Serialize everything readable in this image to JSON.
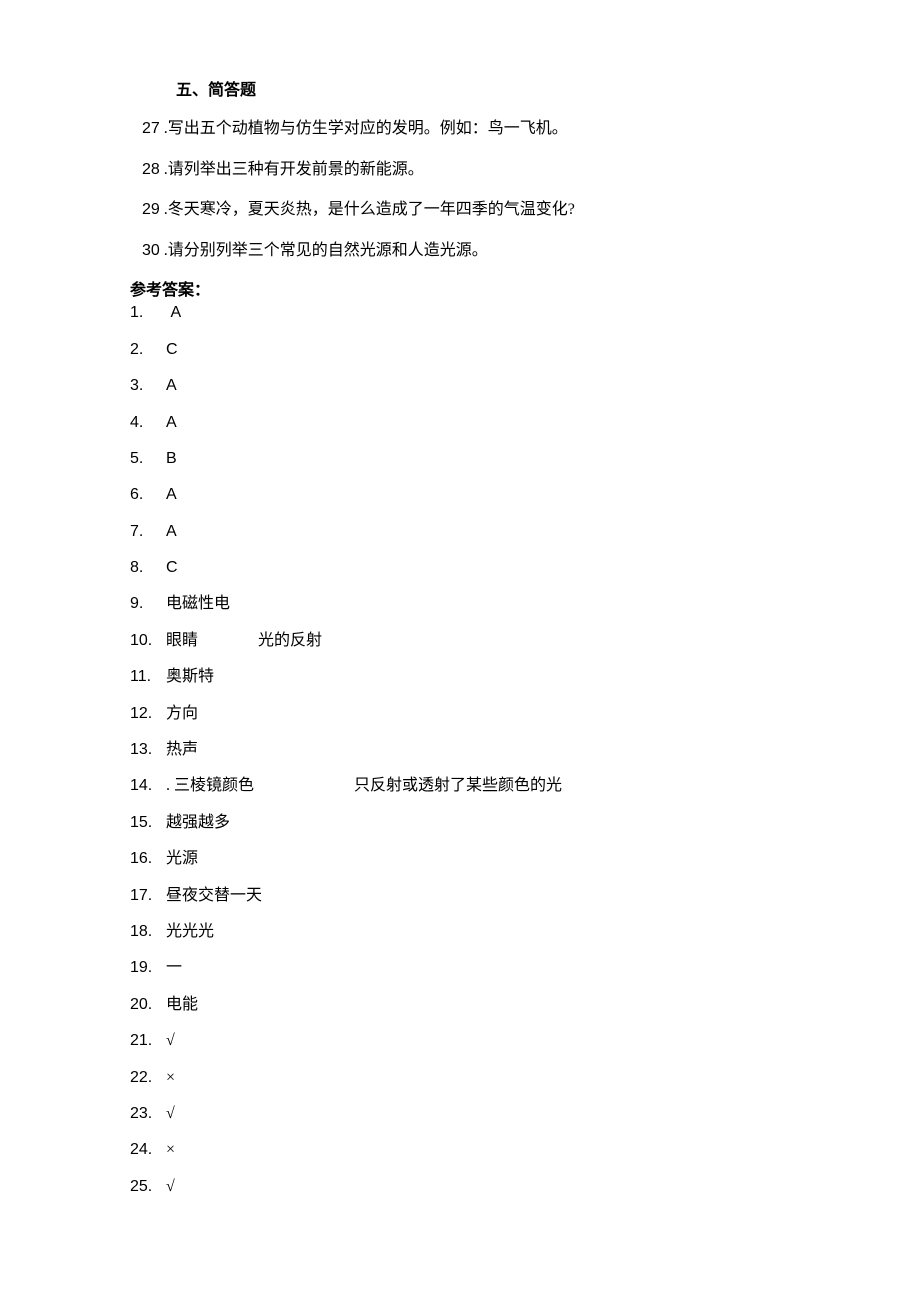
{
  "section_title": "五、简答题",
  "questions": [
    {
      "num": "27",
      "sep": "  .",
      "text": "写出五个动植物与仿生学对应的发明。例如：鸟一飞机。"
    },
    {
      "num": "28",
      "sep": "  .",
      "text": "请列举出三种有开发前景的新能源。"
    },
    {
      "num": "29",
      "sep": "  .",
      "text": "冬天寒冷，夏天炎热，是什么造成了一年四季的气温变化?"
    },
    {
      "num": "30",
      "sep": "  .",
      "text": "请分别列举三个常见的自然光源和人造光源。"
    }
  ],
  "answer_heading": "参考答案：",
  "first_answer": {
    "num": "1.",
    "text": "A"
  },
  "answers": [
    {
      "num": "2.",
      "text": "C",
      "upper": true
    },
    {
      "num": "3.",
      "text": "A",
      "upper": true
    },
    {
      "num": "4.",
      "text": "A",
      "upper": true
    },
    {
      "num": "5.",
      "text": "B",
      "upper": true
    },
    {
      "num": "6.",
      "text": "A",
      "upper": true
    },
    {
      "num": "7.",
      "text": "A",
      "upper": true
    },
    {
      "num": "8.",
      "text": "C",
      "upper": true
    },
    {
      "num": "9.",
      "text": "电磁性电"
    },
    {
      "num": "10.",
      "text": "眼睛",
      "sub": "光的反射"
    },
    {
      "num": "11.",
      "text": "奥斯特"
    },
    {
      "num": "12.",
      "text": "方向"
    },
    {
      "num": "13.",
      "text": "热声"
    },
    {
      "num": "14.",
      "text": ". 三棱镜颜色",
      "sub": "只反射或透射了某些颜色的光",
      "subwide": true
    },
    {
      "num": "15.",
      "text": "越强越多"
    },
    {
      "num": "16.",
      "text": "光源"
    },
    {
      "num": "17.",
      "text": "昼夜交替一天"
    },
    {
      "num": "18.",
      "text": "光光光"
    },
    {
      "num": "19.",
      "text": "一"
    },
    {
      "num": "20.",
      "text": "电能"
    },
    {
      "num": "21.",
      "text": "√"
    },
    {
      "num": "22.",
      "text": "×"
    },
    {
      "num": "23.",
      "text": "√"
    },
    {
      "num": "24.",
      "text": "×"
    },
    {
      "num": "25.",
      "text": "√"
    }
  ]
}
